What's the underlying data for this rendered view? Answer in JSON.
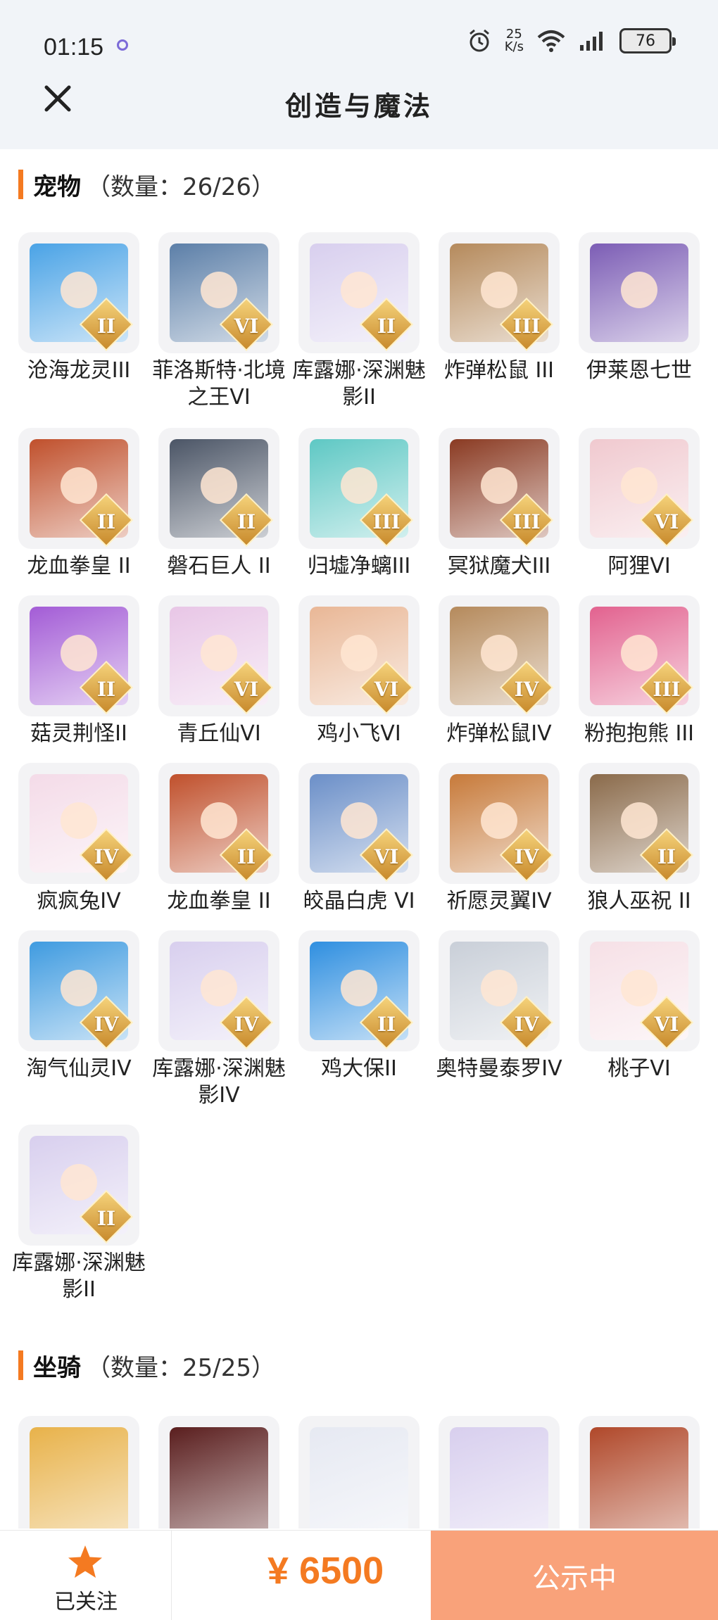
{
  "status_bar": {
    "time": "01:15",
    "net_speed_value": "25",
    "net_speed_unit": "K/s",
    "battery": "76"
  },
  "header": {
    "title": "创造与魔法"
  },
  "pets": {
    "title": "宠物",
    "count": "（数量：26/26）",
    "items": [
      {
        "label": "沧海龙灵III",
        "badge": "II",
        "color": "#4aa3e6"
      },
      {
        "label": "菲洛斯特·北境之王VI",
        "badge": "VI",
        "color": "#5c7fa8"
      },
      {
        "label": "库露娜·深渊魅影II",
        "badge": "II",
        "color": "#d8cfee"
      },
      {
        "label": "炸弹松鼠 III",
        "badge": "III",
        "color": "#b58a5c"
      },
      {
        "label": "伊莱恩七世",
        "badge": "",
        "color": "#7c5db5"
      },
      {
        "label": "龙血拳皇 II",
        "badge": "II",
        "color": "#c0502c"
      },
      {
        "label": "磐石巨人 II",
        "badge": "II",
        "color": "#4b5566"
      },
      {
        "label": "归墟净螭III",
        "badge": "III",
        "color": "#5ec8c4"
      },
      {
        "label": "冥狱魔犬III",
        "badge": "III",
        "color": "#8a3a22"
      },
      {
        "label": "阿狸VI",
        "badge": "VI",
        "color": "#f0c9cf"
      },
      {
        "label": "菇灵荆怪II",
        "badge": "II",
        "color": "#a35cd6"
      },
      {
        "label": "青丘仙VI",
        "badge": "VI",
        "color": "#e8c6e6"
      },
      {
        "label": "鸡小飞VI",
        "badge": "VI",
        "color": "#e9b796"
      },
      {
        "label": "炸弹松鼠IV",
        "badge": "IV",
        "color": "#b58a5c"
      },
      {
        "label": "粉抱抱熊 III",
        "badge": "III",
        "color": "#e2628f"
      },
      {
        "label": "疯疯兔IV",
        "badge": "IV",
        "color": "#f4dbe8"
      },
      {
        "label": "龙血拳皇 II",
        "badge": "II",
        "color": "#c0502c"
      },
      {
        "label": "皎晶白虎 VI",
        "badge": "VI",
        "color": "#6b8fc8"
      },
      {
        "label": "祈愿灵翼IV",
        "badge": "IV",
        "color": "#c77a3a"
      },
      {
        "label": "狼人巫祝 II",
        "badge": "II",
        "color": "#8a6a4a"
      },
      {
        "label": "淘气仙灵IV",
        "badge": "IV",
        "color": "#3f9be0"
      },
      {
        "label": "库露娜·深渊魅影IV",
        "badge": "IV",
        "color": "#d8cfee"
      },
      {
        "label": "鸡大保II",
        "badge": "II",
        "color": "#2f8fe0"
      },
      {
        "label": "奥特曼泰罗IV",
        "badge": "IV",
        "color": "#c9cfd8"
      },
      {
        "label": "桃子VI",
        "badge": "VI",
        "color": "#f6e0e6"
      },
      {
        "label": "库露娜·深渊魅影II",
        "badge": "II",
        "color": "#d8cfee"
      }
    ]
  },
  "mounts": {
    "title": "坐骑",
    "count": "（数量：25/25）",
    "items": [
      {
        "color": "#e8b24a"
      },
      {
        "color": "#5a1e1e"
      },
      {
        "color": "#e6e9f2"
      },
      {
        "color": "#d8cfee"
      },
      {
        "color": "#b0482a"
      }
    ]
  },
  "bottom_bar": {
    "follow_label": "已关注",
    "price": "¥ 6500",
    "publish_label": "公示中"
  }
}
